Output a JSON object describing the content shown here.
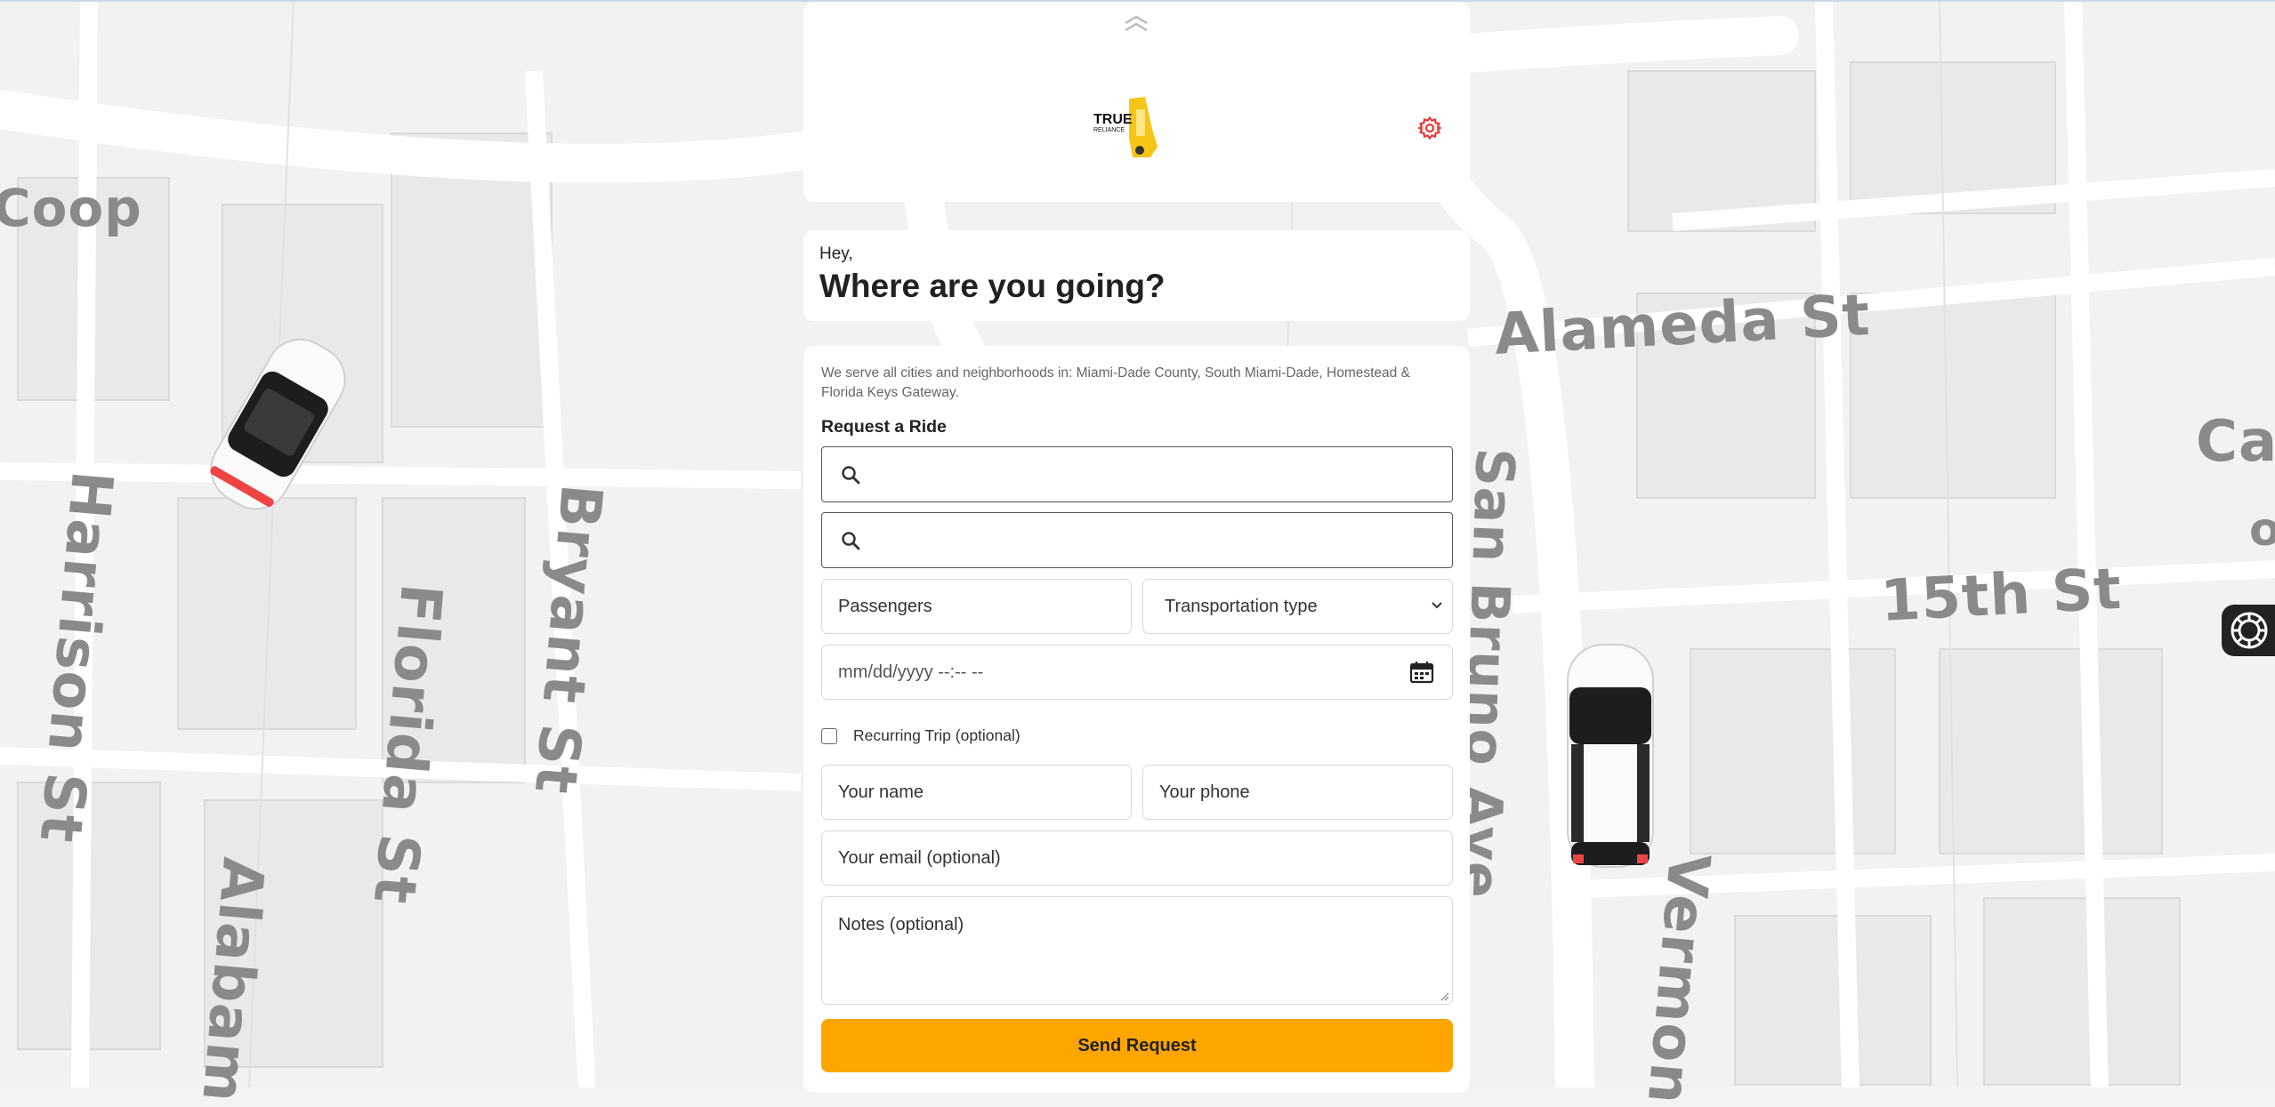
{
  "header": {
    "logo_text": "TRUE RELIANCE",
    "collapse_icon": "chevron-up-double-icon",
    "settings_icon": "gear-icon"
  },
  "greeting": {
    "small": "Hey,",
    "title": "Where are you going?"
  },
  "form": {
    "service_area": "We serve all cities and neighborhoods in: Miami-Dade County, South Miami-Dade, Homestead & Florida Keys Gateway.",
    "title": "Request a Ride",
    "pickup_value": "",
    "dropoff_value": "",
    "passengers_placeholder": "Passengers",
    "transport_select": "Transportation type",
    "datetime_placeholder": "mm/dd/yyyy --:-- --",
    "recurring_label": "Recurring Trip (optional)",
    "name_placeholder": "Your name",
    "phone_placeholder": "Your phone",
    "email_placeholder": "Your email (optional)",
    "notes_placeholder": "Notes (optional)",
    "submit_label": "Send Request"
  },
  "map": {
    "street_labels": [
      "Coop",
      "Harrison St",
      "Alabam",
      "Florida St",
      "Bryant St",
      "Alameda St",
      "San Bruno Ave",
      "15th St",
      "Vermon",
      "Calif",
      "o"
    ]
  },
  "colors": {
    "accent": "#ffa500",
    "settings": "#e53935",
    "logo_yellow": "#f5c518"
  }
}
